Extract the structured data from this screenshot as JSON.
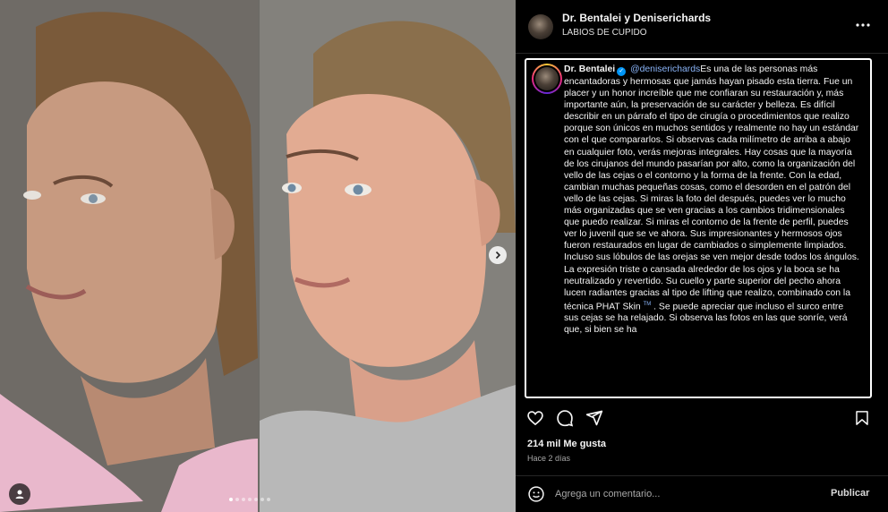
{
  "post": {
    "header": {
      "title": "Dr. Bentalei y Deniserichards",
      "subtitle": "LABIOS DE CUPIDO"
    },
    "carousel": {
      "slide_count": 7,
      "active_index": 0
    },
    "caption": {
      "author": "Dr. Bentalei",
      "verified_glyph": "✓",
      "mention": "@deniserichards",
      "text_part1": "Es una de las personas más encantadoras y hermosas que jamás hayan pisado esta tierra. Fue un placer y un honor increíble que me confiaran su restauración y, más importante aún, la preservación de su carácter y belleza. Es difícil describir en un párrafo el tipo de cirugía o procedimientos que realizo porque son únicos en muchos sentidos y realmente no hay un estándar con el que compararlos. Si observas cada milímetro de arriba a abajo en cualquier foto, verás mejoras integrales. Hay cosas que la mayoría de los cirujanos del mundo pasarían por alto, como la organización del vello de las cejas o el contorno y la forma de la frente. Con la edad, cambian muchas pequeñas cosas, como el desorden en el patrón del vello de las cejas. Si miras la foto del después, puedes ver lo mucho más organizadas que se ven gracias a los cambios tridimensionales que puedo realizar. Si miras el contorno de la frente de perfil, puedes ver lo juvenil que se ve ahora. Sus impresionantes y hermosos ojos fueron restaurados en lugar de cambiados o simplemente limpiados. Incluso sus lóbulos de las orejas se ven mejor desde todos los ángulos. La expresión triste o cansada alrededor de los ojos y la boca se ha neutralizado y revertido. Su cuello y parte superior del pecho ahora lucen radiantes gracias al tipo de lifting que realizo, combinado con la técnica PHAT Skin",
      "trademark": "TM",
      "text_part2": " . Se puede apreciar que incluso el surco entre sus cejas se ha relajado. Si observa las fotos en las que sonríe, verá que, si bien se ha"
    },
    "likes": "214 mil Me gusta",
    "timestamp": "Hace 2 días",
    "composer": {
      "placeholder": "Agrega un comentario...",
      "submit_label": "Publicar"
    },
    "icons": {
      "header_more": "more-horizontal-icon",
      "like": "heart-icon",
      "comment": "comment-bubble-icon",
      "share": "paper-plane-icon",
      "save": "bookmark-icon",
      "emoji": "smiley-icon",
      "next": "chevron-right-icon",
      "tag": "user-tag-icon"
    },
    "colors": {
      "background": "#000000",
      "mention": "#8ab4f8",
      "verified": "#0095f6"
    }
  }
}
